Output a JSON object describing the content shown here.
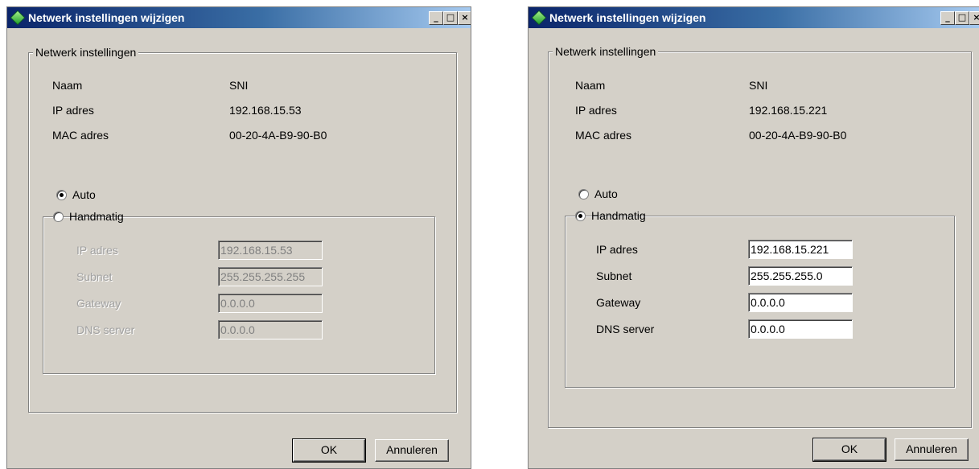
{
  "dialogs": [
    {
      "title": "Netwerk instellingen wijzigen",
      "group_title": "Netwerk instellingen",
      "info": [
        {
          "label": "Naam",
          "value": "SNI"
        },
        {
          "label": "IP adres",
          "value": "192.168.15.53"
        },
        {
          "label": "MAC adres",
          "value": "00-20-4A-B9-90-B0"
        }
      ],
      "mode": "Auto",
      "radio_auto": "Auto",
      "radio_manual": "Handmatig",
      "manual_fields": [
        {
          "label": "IP adres",
          "value": "192.168.15.53"
        },
        {
          "label": "Subnet",
          "value": "255.255.255.255"
        },
        {
          "label": "Gateway",
          "value": "0.0.0.0"
        },
        {
          "label": "DNS server",
          "value": "0.0.0.0"
        }
      ],
      "manual_enabled": false,
      "ok_label": "OK",
      "cancel_label": "Annuleren"
    },
    {
      "title": "Netwerk instellingen wijzigen",
      "group_title": "Netwerk instellingen",
      "info": [
        {
          "label": "Naam",
          "value": "SNI"
        },
        {
          "label": "IP adres",
          "value": "192.168.15.221"
        },
        {
          "label": "MAC adres",
          "value": "00-20-4A-B9-90-B0"
        }
      ],
      "mode": "Handmatig",
      "radio_auto": "Auto",
      "radio_manual": "Handmatig",
      "manual_fields": [
        {
          "label": "IP adres",
          "value": "192.168.15.221"
        },
        {
          "label": "Subnet",
          "value": "255.255.255.0"
        },
        {
          "label": "Gateway",
          "value": "0.0.0.0"
        },
        {
          "label": "DNS server",
          "value": "0.0.0.0"
        }
      ],
      "manual_enabled": true,
      "ok_label": "OK",
      "cancel_label": "Annuleren"
    }
  ],
  "icons": {
    "app": "diamond-icon",
    "minimize": "minimize-icon",
    "maximize": "maximize-icon",
    "close": "close-icon"
  },
  "colors": {
    "titlebar_start": "#0a246a",
    "titlebar_end": "#a6caf0",
    "dialog_bg": "#d4d0c8"
  }
}
